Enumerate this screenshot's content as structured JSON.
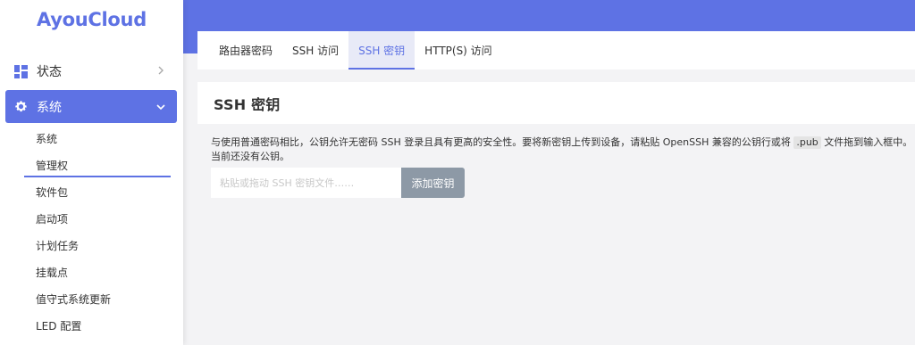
{
  "brand": {
    "name": "AyouCloud",
    "color": "#5e72e4"
  },
  "sidebar": {
    "menu": [
      {
        "label": "状态",
        "icon": "dashboard-icon",
        "expanded": false
      },
      {
        "label": "系统",
        "icon": "gear-icon",
        "expanded": true
      }
    ],
    "submenu": [
      {
        "label": "系统"
      },
      {
        "label": "管理权",
        "active": true
      },
      {
        "label": "软件包"
      },
      {
        "label": "启动项"
      },
      {
        "label": "计划任务"
      },
      {
        "label": "挂载点"
      },
      {
        "label": "值守式系统更新"
      },
      {
        "label": "LED 配置"
      }
    ]
  },
  "tabs": [
    {
      "label": "路由器密码",
      "active": false
    },
    {
      "label": "SSH 访问",
      "active": false
    },
    {
      "label": "SSH 密钥",
      "active": true
    },
    {
      "label": "HTTP(S) 访问",
      "active": false
    }
  ],
  "section": {
    "title": "SSH 密钥",
    "desc_part1": "与使用普通密码相比，公钥允许无密码 SSH 登录且具有更高的安全性。要将新密钥上传到设备，请粘贴 OpenSSH 兼容的公钥行或将",
    "desc_code": ".pub",
    "desc_part2": "文件拖到输入框中。",
    "no_keys": "当前还没有公钥。",
    "input_placeholder": "粘贴或拖动 SSH 密钥文件……",
    "add_button": "添加密钥"
  },
  "colors": {
    "accent": "#5e72e4",
    "button": "#8d99a6",
    "background": "#f3f3f5"
  }
}
